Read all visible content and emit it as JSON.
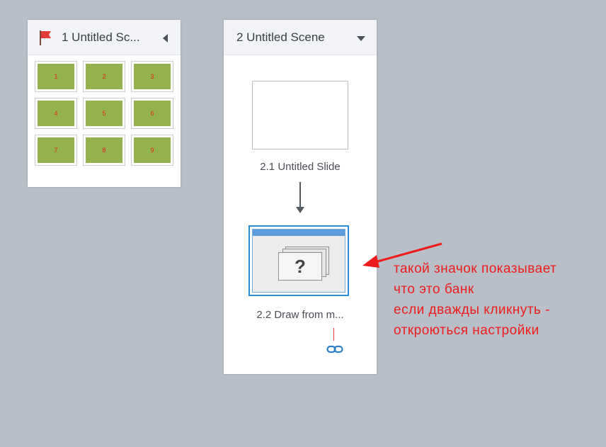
{
  "scenes": [
    {
      "title": "1 Untitled Sc...",
      "slides": [
        "1",
        "2",
        "3",
        "4",
        "5",
        "6",
        "7",
        "8",
        "9"
      ]
    },
    {
      "title": "2 Untitled Scene",
      "slides": [
        {
          "label": "2.1 Untitled Slide"
        },
        {
          "label": "2.2 Draw from m...",
          "bank_icon_text": "?"
        }
      ]
    }
  ],
  "annotation": {
    "lines": [
      "такой значок показывает",
      "что это банк",
      "если дважды кликнуть -",
      "откроються настройки"
    ],
    "color": "#ee1c1c"
  },
  "colors": {
    "background": "#b8bfc8",
    "slide_thumbnail": "#93b24d",
    "selection": "#2b8bd6"
  },
  "icons": [
    "flag-icon",
    "collapse-arrow-icon",
    "dropdown-arrow-icon",
    "question-bank-icon",
    "link-icon"
  ]
}
